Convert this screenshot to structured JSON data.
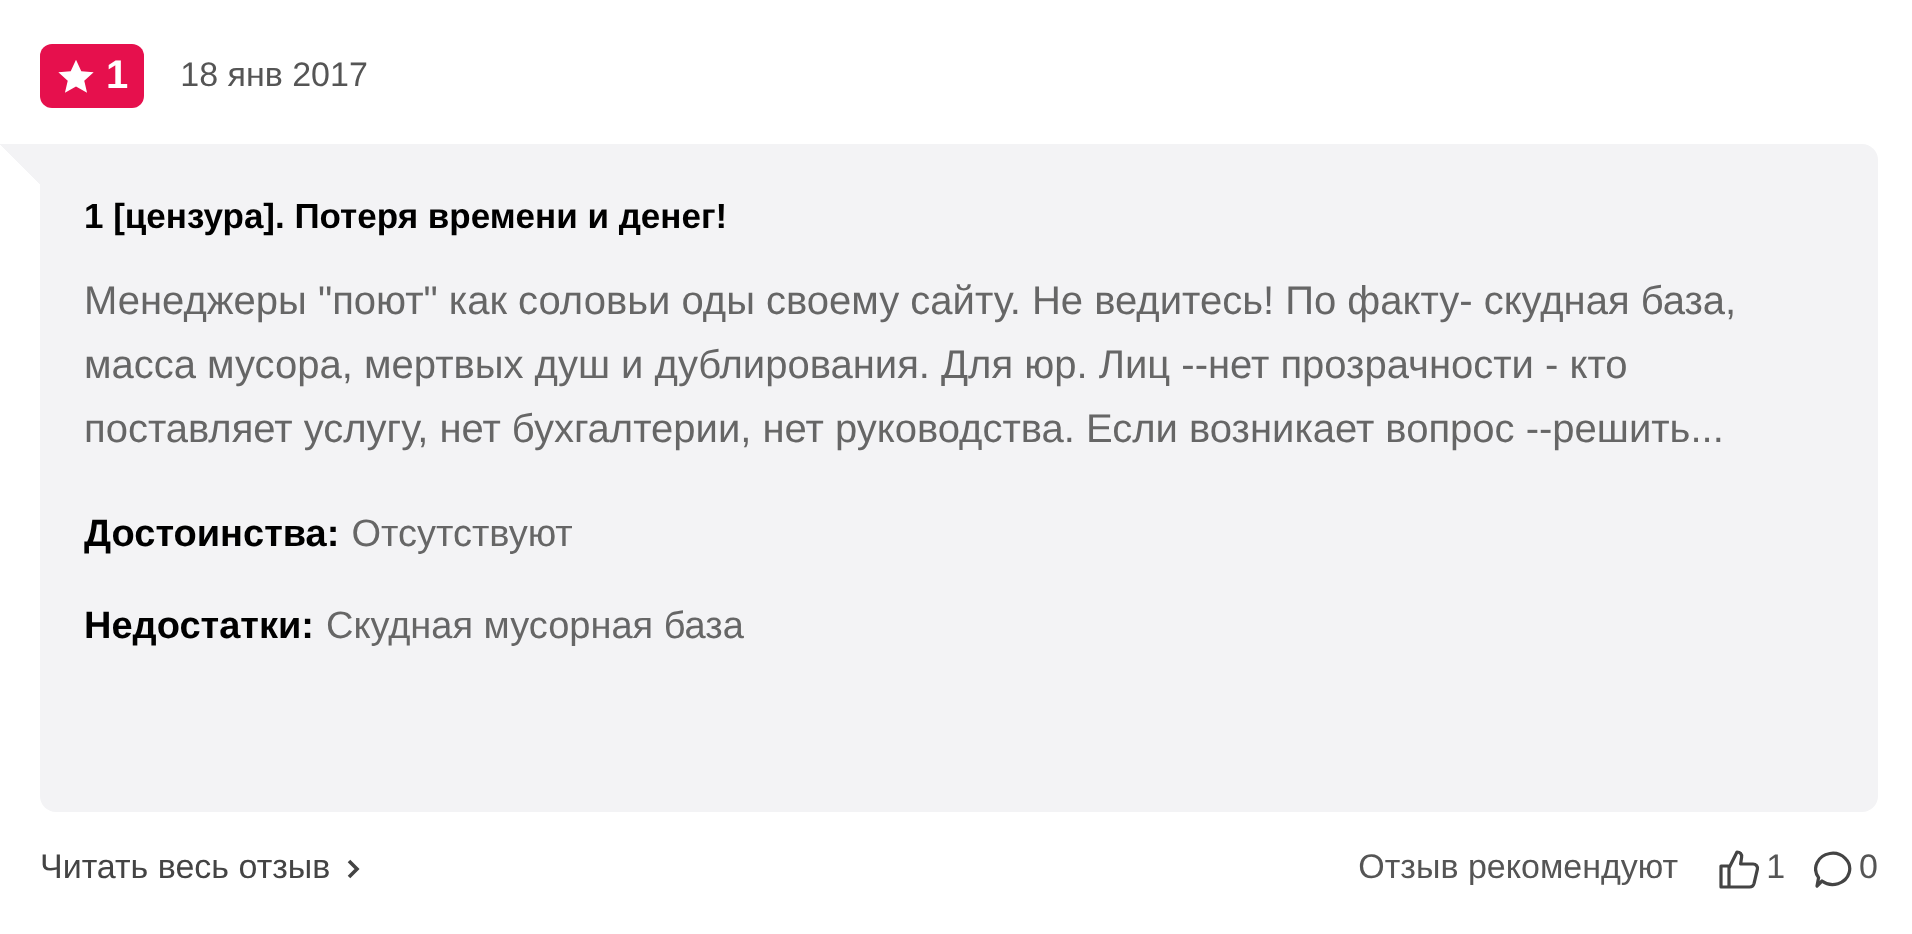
{
  "review": {
    "rating": "1",
    "date": "18 янв 2017",
    "title": "1 [цензура]. Потеря времени и денег!",
    "text": "Менеджеры \"поют\" как соловьи оды своему сайту. Не ведитесь! По факту- скудная база, масса мусора, мертвых душ и дублирования. Для юр. Лиц --нет прозрачности - кто поставляет услугу, нет бухгалтерии, нет руководства. Если возникает вопрос --решить...",
    "details": [
      {
        "label": "Достоинства:",
        "value": "Отсутствуют"
      },
      {
        "label": "Недостатки:",
        "value": "Скудная мусорная база"
      }
    ]
  },
  "footer": {
    "read_more": "Читать весь отзыв",
    "recommend_label": "Отзыв рекомендуют",
    "likes": "1",
    "comments": "0"
  }
}
